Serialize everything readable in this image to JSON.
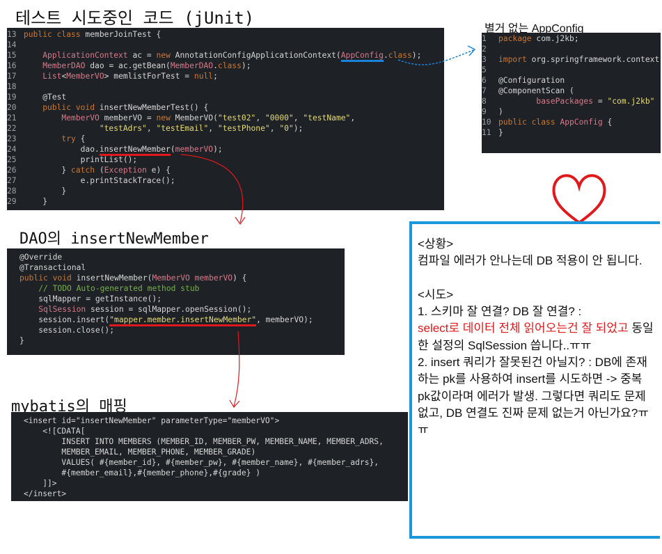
{
  "headings": {
    "test_code": "테스트 시도중인 코드 (jUnit)",
    "app_config": "별거 없는 AppConfig",
    "dao": "DAO의 insertNewMember",
    "mybatis": "mybatis의 매핑"
  },
  "test_code_lines": [
    {
      "n": "13",
      "t": "public class memberJoinTest {"
    },
    {
      "n": "14",
      "t": ""
    },
    {
      "n": "15",
      "t": "    ApplicationContext ac = new AnnotationConfigApplicationContext(AppConfig.class);"
    },
    {
      "n": "16",
      "t": "    MemberDAO dao = ac.getBean(MemberDAO.class);"
    },
    {
      "n": "17",
      "t": "    List<MemberVO> memlistForTest = null;"
    },
    {
      "n": "18",
      "t": ""
    },
    {
      "n": "19",
      "t": "    @Test"
    },
    {
      "n": "20",
      "t": "    public void insertNewMemberTest() {"
    },
    {
      "n": "21",
      "t": "        MemberVO memberVO = new MemberVO(\"test02\", \"0000\", \"testName\","
    },
    {
      "n": "22",
      "t": "                \"testAdrs\", \"testEmail\", \"testPhone\", \"0\");"
    },
    {
      "n": "23",
      "t": "        try {"
    },
    {
      "n": "24",
      "t": "            dao.insertNewMember(memberVO);"
    },
    {
      "n": "25",
      "t": "            printList();"
    },
    {
      "n": "26",
      "t": "        } catch (Exception e) {"
    },
    {
      "n": "27",
      "t": "            e.printStackTrace();"
    },
    {
      "n": "28",
      "t": "        }"
    },
    {
      "n": "29",
      "t": "    }"
    }
  ],
  "app_config_lines": [
    {
      "n": "1",
      "t": "package com.j2kb;"
    },
    {
      "n": "2",
      "t": ""
    },
    {
      "n": "3",
      "t": "import org.springframework.context"
    },
    {
      "n": "5",
      "t": ""
    },
    {
      "n": "6",
      "t": "@Configuration"
    },
    {
      "n": "7",
      "t": "@ComponentScan ("
    },
    {
      "n": "8",
      "t": "        basePackages = \"com.j2kb\""
    },
    {
      "n": "9",
      "t": ")"
    },
    {
      "n": "10",
      "t": "public class AppConfig {"
    },
    {
      "n": "11",
      "t": "}"
    }
  ],
  "dao_lines": [
    {
      "t": "@Override"
    },
    {
      "t": "@Transactional"
    },
    {
      "t": "public void insertNewMember(MemberVO memberVO) {"
    },
    {
      "t": "    // TODO Auto-generated method stub"
    },
    {
      "t": "    sqlMapper = getInstance();"
    },
    {
      "t": "    SqlSession session = sqlMapper.openSession();"
    },
    {
      "t": "    session.insert(\"mapper.member.insertNewMember\", memberVO);"
    },
    {
      "t": "    session.close();"
    },
    {
      "t": "}"
    }
  ],
  "mybatis_lines": [
    {
      "t": "<insert id=\"insertNewMember\" parameterType=\"memberVO\">"
    },
    {
      "t": "    <![CDATA["
    },
    {
      "t": "        INSERT INTO MEMBERS (MEMBER_ID, MEMBER_PW, MEMBER_NAME, MEMBER_ADRS,"
    },
    {
      "t": "        MEMBER_EMAIL, MEMBER_PHONE, MEMBER_GRADE)"
    },
    {
      "t": "        VALUES( #{member_id}, #{member_pw}, #{member_name}, #{member_adrs},"
    },
    {
      "t": "        #{member_email},#{member_phone},#{grade} )"
    },
    {
      "t": "    ]]>"
    },
    {
      "t": "</insert>"
    }
  ],
  "note": {
    "situation_title": "<상황>",
    "situation_body": "컴파일 에러가 안나는데 DB 적용이 안 됩니다.",
    "attempt_title": "<시도>",
    "attempt_1_a": "1. 스키마 잘 연결? DB 잘 연결? :",
    "attempt_1_red": "select로 데이터 전체 읽어오는건 잘 되었고",
    "attempt_1_b": " 동일한 설정의 SqlSession 씁니다..ㅠㅠ",
    "attempt_2": "2. insert 쿼리가 잘못된건 아닐지? : DB에 존재하는 pk를 사용하여 insert를 시도하면 -> 중복 pk값이라며 에러가 발생. 그렇다면 쿼리도 문제 없고, DB 연결도 진짜 문제 없는거 아닌가요?ㅠㅠ"
  },
  "colors": {
    "code_bg": "#1e2125",
    "annotation_red": "#e0191d",
    "annotation_blue": "#1883d8",
    "note_border": "#1a96dc",
    "heart": "#e0191d"
  }
}
